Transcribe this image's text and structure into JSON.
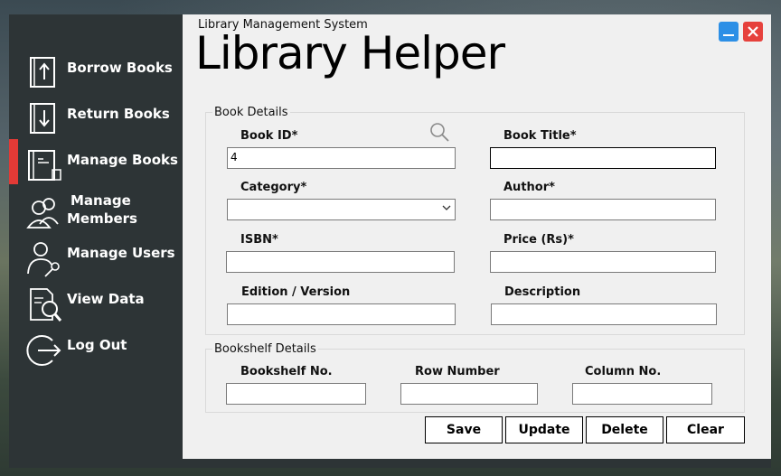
{
  "app": {
    "subtitle": "Library  Management System",
    "title": "Library Helper"
  },
  "sidebar": {
    "items": [
      {
        "label": "Borrow Books",
        "icon": "borrow-book-icon"
      },
      {
        "label": "Return Books",
        "icon": "return-book-icon"
      },
      {
        "label": "Manage Books",
        "icon": "manage-book-icon",
        "active": true
      },
      {
        "label_line1": "Manage",
        "label_line2": "Members",
        "icon": "members-icon"
      },
      {
        "label": "Manage Users",
        "icon": "user-key-icon"
      },
      {
        "label": "View Data",
        "icon": "view-data-icon"
      },
      {
        "label": "Log Out",
        "icon": "logout-icon"
      }
    ]
  },
  "book_details": {
    "legend": "Book Details",
    "book_id": {
      "label": "Book ID*",
      "value": "4"
    },
    "book_title": {
      "label": "Book Title*",
      "value": ""
    },
    "category": {
      "label": "Category*",
      "value": ""
    },
    "author": {
      "label": "Author*",
      "value": ""
    },
    "isbn": {
      "label": "ISBN*",
      "value": ""
    },
    "price": {
      "label": "Price (Rs)*",
      "value": ""
    },
    "edition": {
      "label": "Edition / Version",
      "value": ""
    },
    "description": {
      "label": "Description",
      "value": ""
    }
  },
  "bookshelf_details": {
    "legend": "Bookshelf Details",
    "bookshelf_no": {
      "label": "Bookshelf No.",
      "value": ""
    },
    "row_number": {
      "label": "Row Number",
      "value": ""
    },
    "column_no": {
      "label": "Column No.",
      "value": ""
    }
  },
  "actions": {
    "save": "Save",
    "update": "Update",
    "delete": "Delete",
    "clear": "Clear"
  },
  "colors": {
    "sidebar": "#2d3436",
    "active_indicator": "#e23a36",
    "minimize": "#2c8fe6",
    "close": "#e6413c"
  }
}
